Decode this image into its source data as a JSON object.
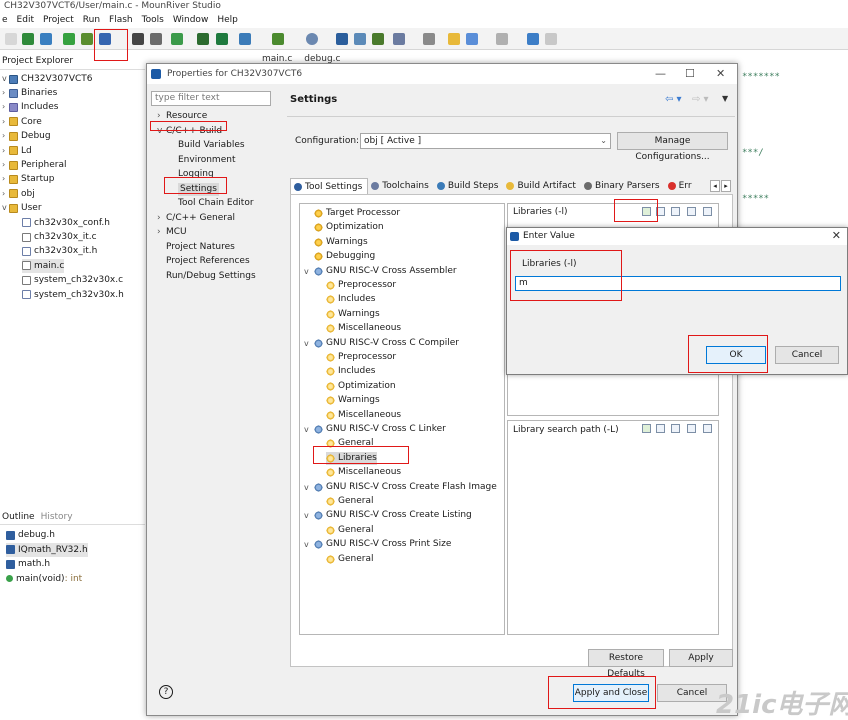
{
  "window": {
    "title": "CH32V307VCT6/User/main.c - MounRiver Studio"
  },
  "menu": [
    "e",
    "Edit",
    "Project",
    "Run",
    "Flash",
    "Tools",
    "Window",
    "Help"
  ],
  "project_explorer": {
    "title": "Project Explorer",
    "root": "CH32V307VCT6",
    "items": [
      {
        "label": "Binaries",
        "icon": "binaries-icon",
        "indent": 1,
        "expander": ">"
      },
      {
        "label": "Includes",
        "icon": "includes-icon",
        "indent": 1,
        "expander": ">"
      },
      {
        "label": "Core",
        "icon": "folder-icon",
        "indent": 1,
        "expander": ">"
      },
      {
        "label": "Debug",
        "icon": "folder-icon",
        "indent": 1,
        "expander": ">"
      },
      {
        "label": "Ld",
        "icon": "folder-icon",
        "indent": 1,
        "expander": ">"
      },
      {
        "label": "Peripheral",
        "icon": "folder-icon",
        "indent": 1,
        "expander": ">"
      },
      {
        "label": "Startup",
        "icon": "folder-icon",
        "indent": 1,
        "expander": ">"
      },
      {
        "label": "obj",
        "icon": "folder-icon",
        "indent": 1,
        "expander": ">"
      },
      {
        "label": "User",
        "icon": "folder-icon",
        "indent": 1,
        "expander": "v"
      },
      {
        "label": "ch32v30x_conf.h",
        "icon": "h-file-icon",
        "indent": 2,
        "expander": ""
      },
      {
        "label": "ch32v30x_it.c",
        "icon": "c-file-icon",
        "indent": 2,
        "expander": ""
      },
      {
        "label": "ch32v30x_it.h",
        "icon": "h-file-icon",
        "indent": 2,
        "expander": ""
      },
      {
        "label": "main.c",
        "icon": "c-file-icon",
        "indent": 2,
        "expander": ""
      },
      {
        "label": "system_ch32v30x.c",
        "icon": "c-file-icon",
        "indent": 2,
        "expander": ""
      },
      {
        "label": "system_ch32v30x.h",
        "icon": "h-file-icon",
        "indent": 2,
        "expander": ""
      }
    ]
  },
  "outline": {
    "tabs": [
      "Outline",
      "History"
    ],
    "items": [
      {
        "label": "debug.h"
      },
      {
        "label": "IQmath_RV32.h"
      },
      {
        "label": "math.h"
      },
      {
        "label": "main(void)",
        "suffix": " : int"
      }
    ]
  },
  "editor": {
    "tabs": [
      "main.c",
      "debug.c"
    ]
  },
  "properties_dialog": {
    "title": "Properties for CH32V307VCT6",
    "filter_placeholder": "type filter text",
    "nav": [
      {
        "label": "Resource",
        "indent": 1,
        "expander": ">"
      },
      {
        "label": "C/C++ Build",
        "indent": 1,
        "expander": "v"
      },
      {
        "label": "Build Variables",
        "indent": 2
      },
      {
        "label": "Environment",
        "indent": 2
      },
      {
        "label": "Logging",
        "indent": 2
      },
      {
        "label": "Settings",
        "indent": 2,
        "selected": true
      },
      {
        "label": "Tool Chain Editor",
        "indent": 2
      },
      {
        "label": "C/C++ General",
        "indent": 1,
        "expander": ">"
      },
      {
        "label": "MCU",
        "indent": 1,
        "expander": ">"
      },
      {
        "label": "Project Natures",
        "indent": 1
      },
      {
        "label": "Project References",
        "indent": 1
      },
      {
        "label": "Run/Debug Settings",
        "indent": 1
      }
    ],
    "page_title": "Settings",
    "configuration_label": "Configuration:",
    "configuration_value": "obj  [ Active ]",
    "manage_button": "Manage Configurations...",
    "tabs": [
      "Tool Settings",
      "Toolchains",
      "Build Steps",
      "Build Artifact",
      "Binary Parsers",
      "Err"
    ],
    "tool_tree": [
      {
        "label": "Target Processor",
        "level": 0,
        "icon": "gear"
      },
      {
        "label": "Optimization",
        "level": 0,
        "icon": "gear"
      },
      {
        "label": "Warnings",
        "level": 0,
        "icon": "gear"
      },
      {
        "label": "Debugging",
        "level": 0,
        "icon": "gear"
      },
      {
        "label": "GNU RISC-V Cross Assembler",
        "level": 0,
        "icon": "tool",
        "expander": "v"
      },
      {
        "label": "Preprocessor",
        "level": 1,
        "icon": "sub"
      },
      {
        "label": "Includes",
        "level": 1,
        "icon": "sub"
      },
      {
        "label": "Warnings",
        "level": 1,
        "icon": "sub"
      },
      {
        "label": "Miscellaneous",
        "level": 1,
        "icon": "sub"
      },
      {
        "label": "GNU RISC-V Cross C Compiler",
        "level": 0,
        "icon": "tool",
        "expander": "v"
      },
      {
        "label": "Preprocessor",
        "level": 1,
        "icon": "sub"
      },
      {
        "label": "Includes",
        "level": 1,
        "icon": "sub"
      },
      {
        "label": "Optimization",
        "level": 1,
        "icon": "sub"
      },
      {
        "label": "Warnings",
        "level": 1,
        "icon": "sub"
      },
      {
        "label": "Miscellaneous",
        "level": 1,
        "icon": "sub"
      },
      {
        "label": "GNU RISC-V Cross C Linker",
        "level": 0,
        "icon": "tool",
        "expander": "v"
      },
      {
        "label": "General",
        "level": 1,
        "icon": "sub"
      },
      {
        "label": "Libraries",
        "level": 1,
        "icon": "sub",
        "selected": true
      },
      {
        "label": "Miscellaneous",
        "level": 1,
        "icon": "sub"
      },
      {
        "label": "GNU RISC-V Cross Create Flash Image",
        "level": 0,
        "icon": "tool",
        "expander": "v"
      },
      {
        "label": "General",
        "level": 1,
        "icon": "sub"
      },
      {
        "label": "GNU RISC-V Cross Create Listing",
        "level": 0,
        "icon": "tool",
        "expander": "v"
      },
      {
        "label": "General",
        "level": 1,
        "icon": "sub"
      },
      {
        "label": "GNU RISC-V Cross Print Size",
        "level": 0,
        "icon": "tool",
        "expander": "v"
      },
      {
        "label": "General",
        "level": 1,
        "icon": "sub"
      }
    ],
    "libraries_label": "Libraries (-l)",
    "library_search_path_label": "Library search path (-L)",
    "restore_defaults_button": "Restore Defaults",
    "apply_button": "Apply",
    "apply_close_button": "Apply and Close",
    "cancel_button": "Cancel"
  },
  "enter_value_dialog": {
    "title": "Enter Value",
    "field_label": "Libraries (-l)",
    "value": "m",
    "ok_button": "OK",
    "cancel_button": "Cancel"
  },
  "watermark": "21ic电子网",
  "colors": {
    "highlight": "#e01818",
    "accent": "#0078d7"
  }
}
